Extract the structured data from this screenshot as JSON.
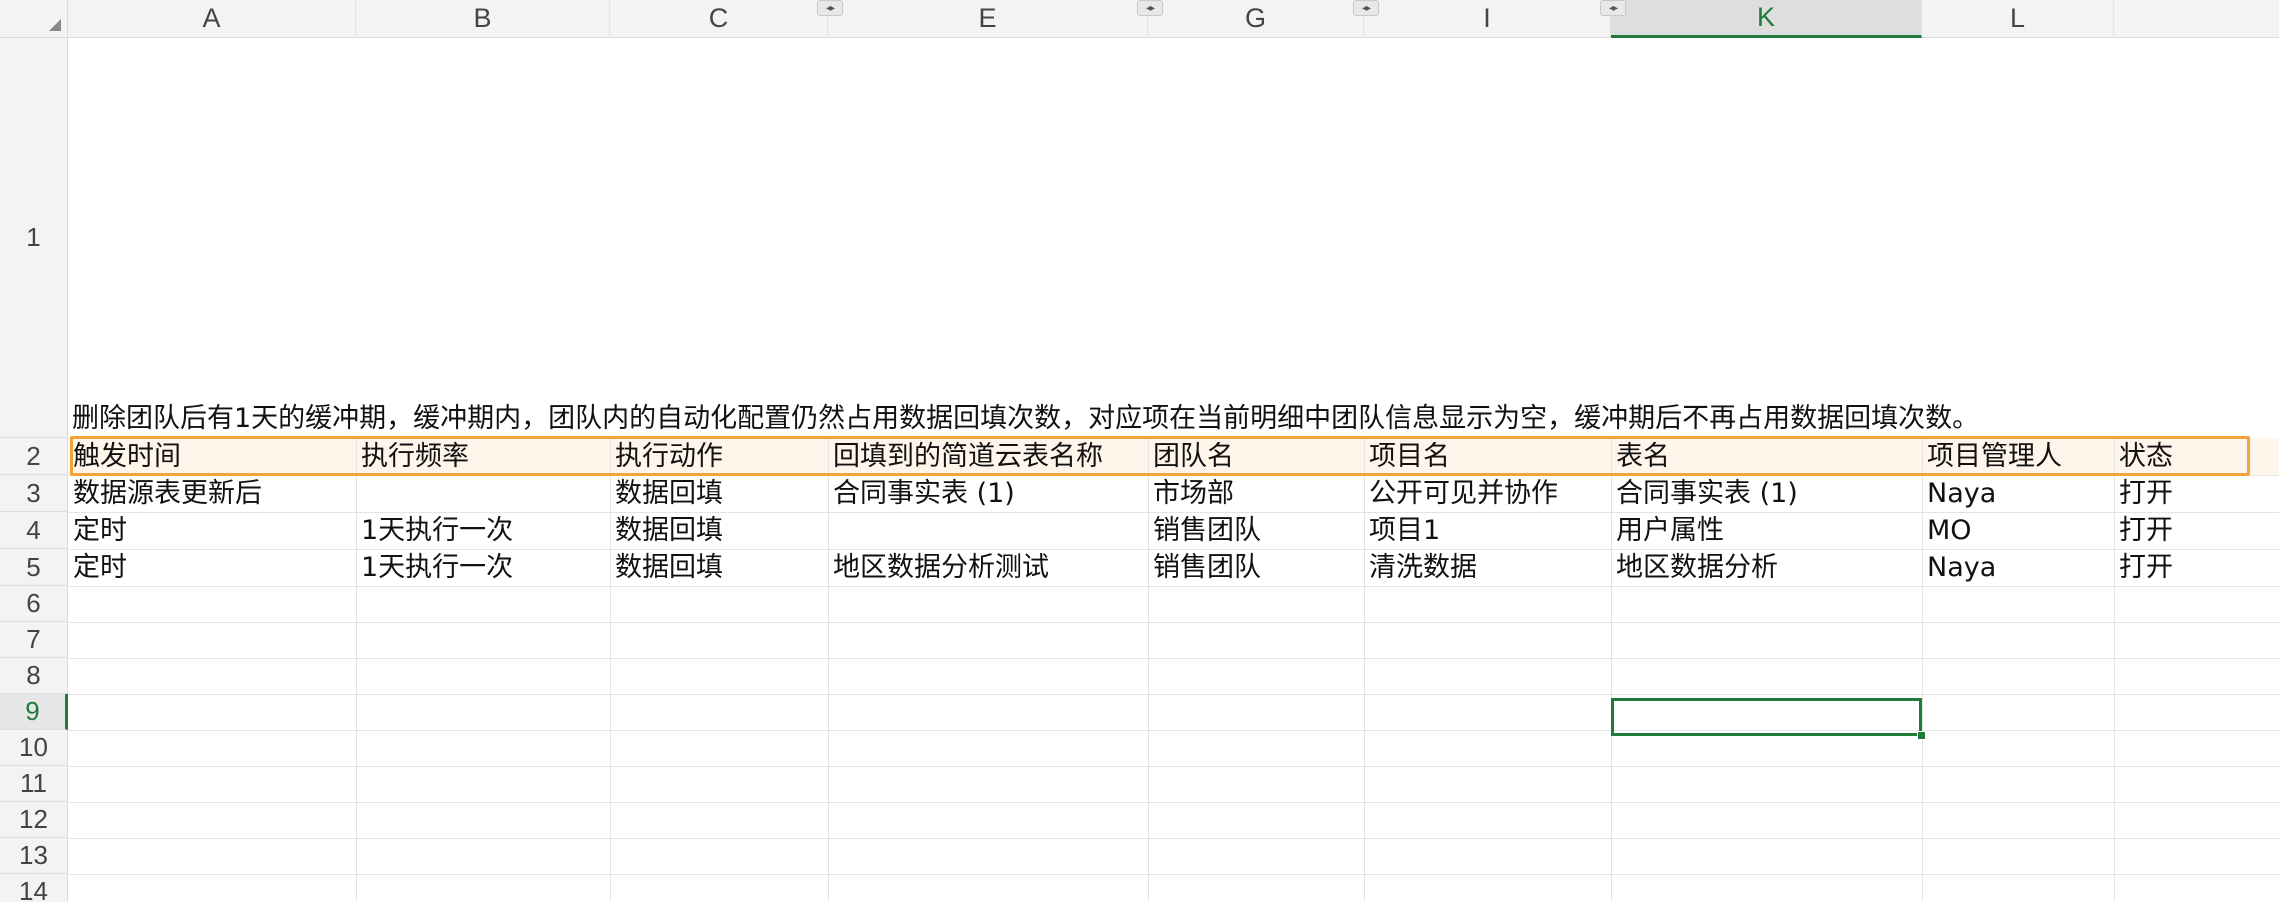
{
  "columns": [
    "A",
    "B",
    "C",
    "E",
    "G",
    "I",
    "K",
    "L"
  ],
  "rows": [
    "1",
    "2",
    "3",
    "4",
    "5",
    "6",
    "7",
    "8",
    "9",
    "10",
    "11",
    "12",
    "13",
    "14"
  ],
  "note": "删除团队后有1天的缓冲期，缓冲期内，团队内的自动化配置仍然占用数据回填次数，对应项在当前明细中团队信息显示为空，缓冲期后不再占用数据回填次数。",
  "table": {
    "headers": [
      "触发时间",
      "执行频率",
      "执行动作",
      "回填到的简道云表名称",
      "团队名",
      "项目名",
      "表名",
      "项目管理人",
      "状态"
    ],
    "rows": [
      [
        "数据源表更新后",
        "",
        "数据回填",
        "合同事实表 (1)",
        "市场部",
        "公开可见并协作",
        "合同事实表 (1)",
        "Naya",
        "打开"
      ],
      [
        "定时",
        "1天执行一次",
        "数据回填",
        "",
        "销售团队",
        "项目1",
        "用户属性",
        "MO",
        "打开"
      ],
      [
        "定时",
        "1天执行一次",
        "数据回填",
        "地区数据分析测试",
        "销售团队",
        "清洗数据",
        "地区数据分析",
        "Naya",
        "打开"
      ]
    ]
  },
  "selection": {
    "active_column": "K",
    "active_row": "9"
  },
  "colors": {
    "selection": "#1e7b3a",
    "highlight_border": "#f2a33a",
    "highlight_fill": "#fff5ea"
  }
}
